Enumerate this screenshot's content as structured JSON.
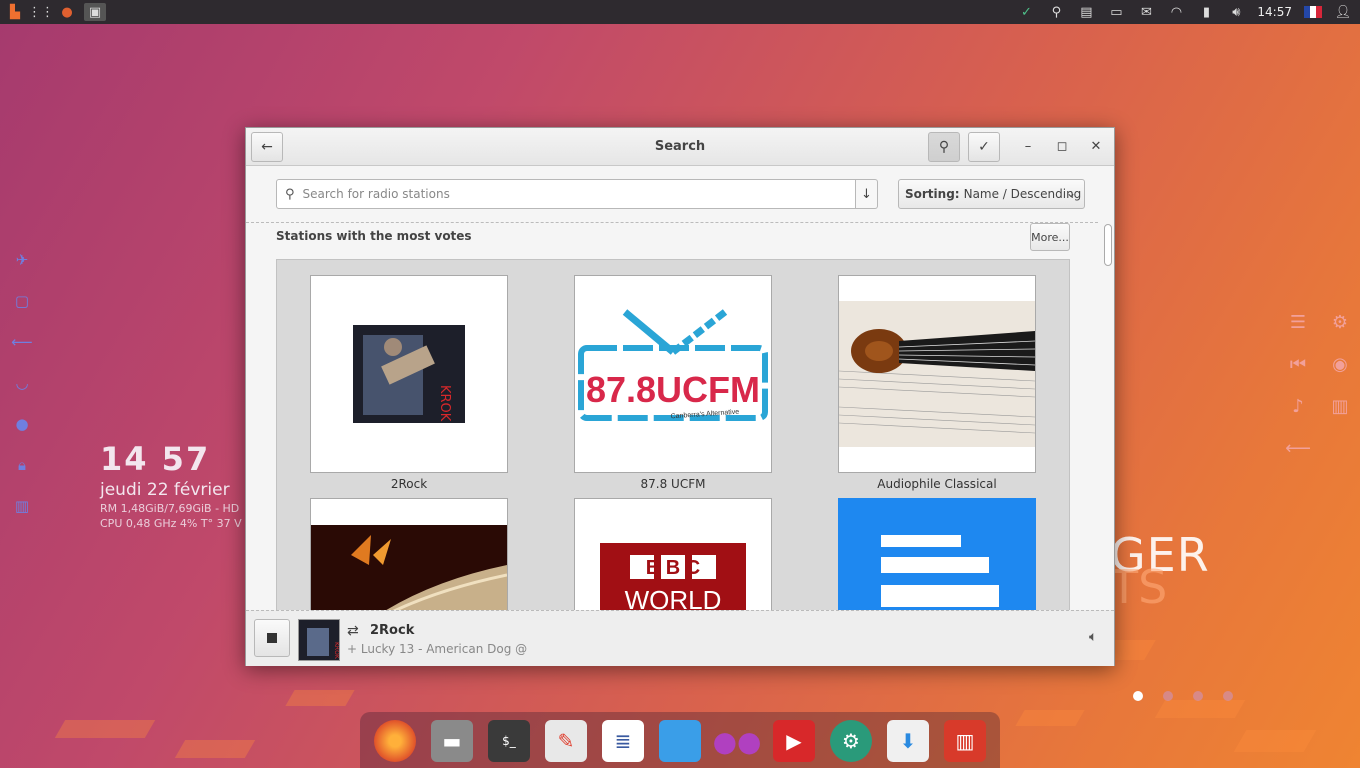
{
  "topbar": {
    "clock": "14:57",
    "left_icons": [
      "apps-icon",
      "grid-icon",
      "firefox-icon",
      "terminal-icon"
    ],
    "right_icons": [
      "chevron-down-icon",
      "search-icon",
      "radio-icon",
      "window-icon",
      "mail-icon",
      "wifi-icon",
      "battery-icon",
      "volume-icon"
    ]
  },
  "conky": {
    "time": "14 57",
    "date": "jeudi 22 février",
    "ram": "RM 1,48GiB/7,69GiB - HD",
    "cpu": "CPU 0,48 GHz 4% T° 37  V"
  },
  "background_text": {
    "line1": "GER",
    "line2": "TS"
  },
  "window": {
    "title": "Search",
    "search_placeholder": "Search for radio stations",
    "sorting_label": "Sorting:",
    "sorting_value": "Name / Descending",
    "section_title": "Stations with the most votes",
    "more_label": "More...",
    "stations": [
      {
        "name": "2Rock"
      },
      {
        "name": "87.8 UCFM"
      },
      {
        "name": "Audiophile Classical"
      },
      {
        "name": ""
      },
      {
        "name": ""
      },
      {
        "name": ""
      }
    ],
    "ucfm_logo": {
      "main": "87.8UCFM",
      "sub": "Canberra's Alternative"
    },
    "bbc_logo": {
      "line1": "B B C",
      "line2": "WORLD"
    },
    "now_playing": {
      "station": "2Rock",
      "song": "+ Lucky 13 - American Dog @"
    }
  },
  "colors": {
    "accent_blue": "#1e88f0",
    "bbc_red": "#a10f14",
    "ucfm_blue": "#2aa5d6",
    "ucfm_red": "#d8284a"
  }
}
